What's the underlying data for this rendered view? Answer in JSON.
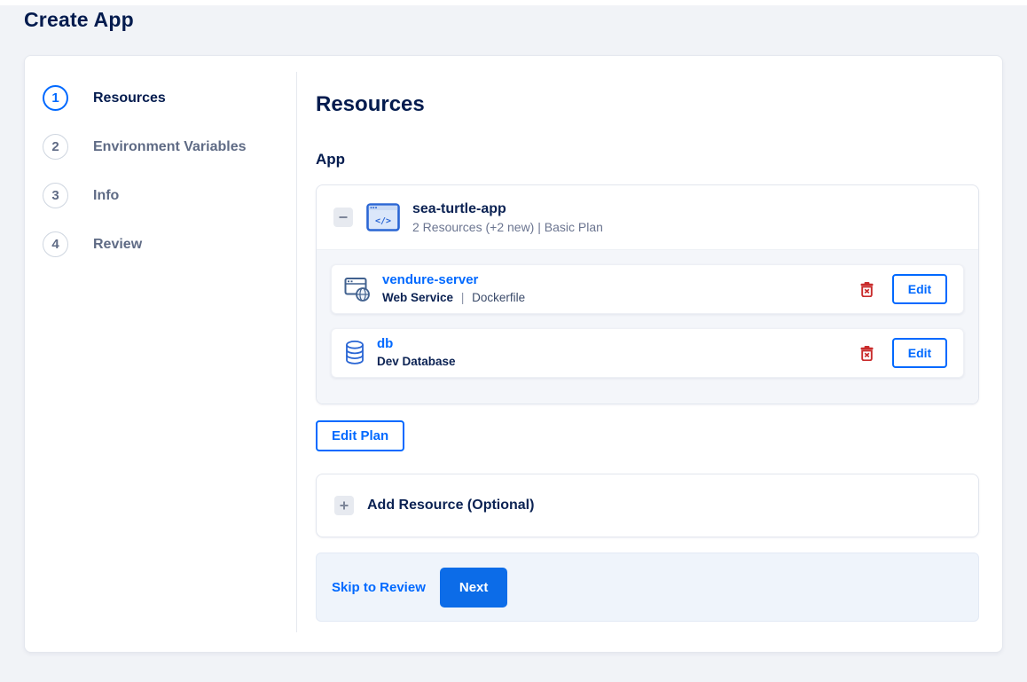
{
  "page": {
    "title": "Create App"
  },
  "stepper": {
    "steps": [
      {
        "number": "1",
        "label": "Resources"
      },
      {
        "number": "2",
        "label": "Environment Variables"
      },
      {
        "number": "3",
        "label": "Info"
      },
      {
        "number": "4",
        "label": "Review"
      }
    ]
  },
  "main": {
    "heading": "Resources",
    "section_label": "App",
    "app_group": {
      "name": "sea-turtle-app",
      "summary": "2 Resources (+2 new) | Basic Plan",
      "resources": [
        {
          "name": "vendure-server",
          "type": "Web Service",
          "separator": "|",
          "source": "Dockerfile",
          "edit_label": "Edit"
        },
        {
          "name": "db",
          "type": "Dev Database",
          "edit_label": "Edit"
        }
      ]
    },
    "edit_plan_label": "Edit Plan",
    "add_resource": {
      "label": "Add Resource (Optional)"
    },
    "footer": {
      "skip_label": "Skip to Review",
      "next_label": "Next"
    }
  },
  "icons": {
    "code_glyph": "</>"
  },
  "colors": {
    "accent_blue": "#0069ff",
    "next_button_blue": "#0c6ce8",
    "navy_text": "#031b4e",
    "muted_text": "#5f6b85",
    "danger_red": "#c92c2c",
    "page_background": "#f1f3f7",
    "panel_background": "#f4f6fa",
    "footer_background": "#eff4fb"
  }
}
